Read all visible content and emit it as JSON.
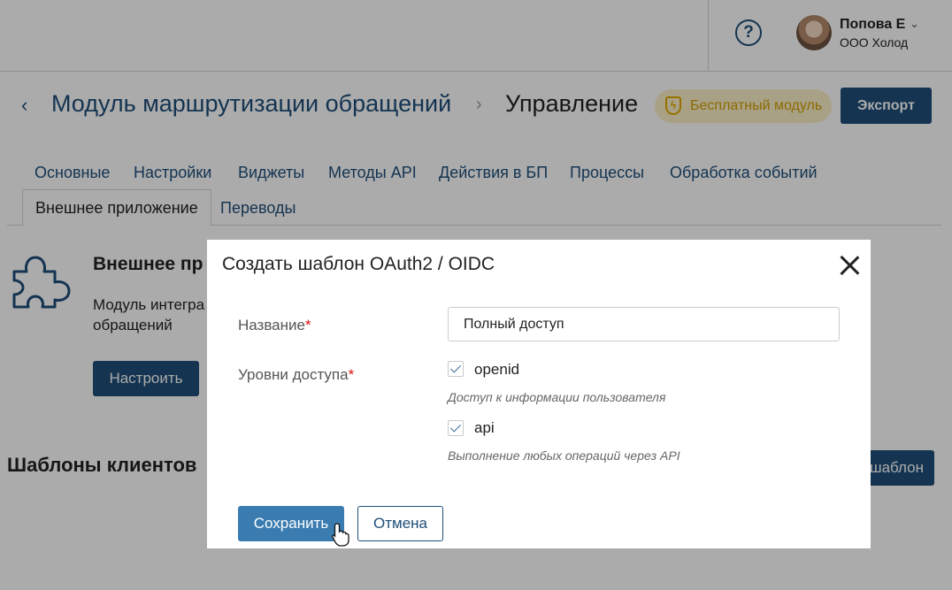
{
  "header": {
    "help_icon": "question-circle-icon",
    "user_name": "Попова Е",
    "user_org": "ООО Холод"
  },
  "title_bar": {
    "module_name": "Модуль маршрутизации обращений",
    "current_page": "Управление",
    "badge": "Бесплатный модуль",
    "export_label": "Экспорт"
  },
  "tabs": [
    {
      "label": "Основные"
    },
    {
      "label": "Настройки"
    },
    {
      "label": "Виджеты"
    },
    {
      "label": "Методы API"
    },
    {
      "label": "Действия в БП"
    },
    {
      "label": "Процессы"
    },
    {
      "label": "Обработка событий"
    },
    {
      "label": "Внешнее приложение",
      "active": true
    },
    {
      "label": "Переводы"
    }
  ],
  "background": {
    "section_title": "Внешнее пр",
    "section_desc": "Модуль интегра обращений",
    "setup_label": "Настроить",
    "templates_title": "Шаблоны клиентов",
    "template_button": "шаблон"
  },
  "modal": {
    "title": "Создать шаблон OAuth2 / OIDC",
    "name_label": "Название",
    "name_value": "Полный доступ",
    "access_label": "Уровни доступа",
    "required_mark": "*",
    "scopes": [
      {
        "name": "openid",
        "checked": true,
        "hint": "Доступ к информации пользователя"
      },
      {
        "name": "api",
        "checked": true,
        "hint": "Выполнение любых операций через API"
      }
    ],
    "save_label": "Сохранить",
    "cancel_label": "Отмена"
  },
  "colors": {
    "primary": "#1e4e79",
    "save_button": "#3a7cb0",
    "badge_bg": "#fdf1c8",
    "badge_text": "#d1a000",
    "required": "#dd1111"
  }
}
